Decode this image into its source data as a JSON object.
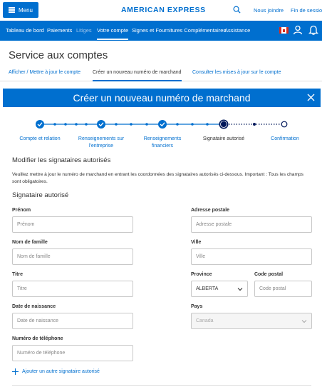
{
  "topbar": {
    "menu_label": "Menu",
    "brand": "AMERICAN EXPRESS",
    "join_label": "Nous joindre",
    "logout_label": "Fin de session"
  },
  "nav": {
    "items": [
      {
        "label": "Tableau de bord"
      },
      {
        "label": "Paiements"
      },
      {
        "label": "Litiges"
      },
      {
        "label": "Votre compte"
      },
      {
        "label": "Signes et Fournitures Complémentaires"
      },
      {
        "label": "Assistance"
      }
    ]
  },
  "page": {
    "title": "Service aux comptes",
    "subtabs": [
      {
        "label": "Afficher / Mettre à jour le compte"
      },
      {
        "label": "Créer un nouveau numéro de marchand"
      },
      {
        "label": "Consulter les mises à jour sur le compte"
      }
    ]
  },
  "modal": {
    "title": "Créer un nouveau numéro de marchand",
    "steps": [
      {
        "label": "Compte et relation"
      },
      {
        "label": "Renseignements sur l'entreprise"
      },
      {
        "label": "Renseignements financiers"
      },
      {
        "label": "Signataire autorisé"
      },
      {
        "label": "Confirmation"
      }
    ],
    "section_title": "Modifier les signataires autorisés",
    "intro": "Veuillez mettre à jour le numéro de marchand en entrant les coordonnées des signataires autorisés ci-dessous. Important : Tous les champs sont obligatoires.",
    "signatory_title": "Signataire autorisé",
    "fields": {
      "first_name": {
        "label": "Prénom",
        "placeholder": "Prénom"
      },
      "address": {
        "label": "Adresse postale",
        "placeholder": "Adresse postale"
      },
      "last_name": {
        "label": "Nom de famille",
        "placeholder": "Nom de famille"
      },
      "city": {
        "label": "Ville",
        "placeholder": "Ville"
      },
      "job_title": {
        "label": "Titre",
        "placeholder": "Titre"
      },
      "province": {
        "label": "Province",
        "value": "ALBERTA"
      },
      "postal_code": {
        "label": "Code postal",
        "placeholder": "Code postal"
      },
      "birth_date": {
        "label": "Date de naissance",
        "placeholder": "Date de naissance"
      },
      "country": {
        "label": "Pays",
        "value": "Canada"
      },
      "phone": {
        "label": "Numéro de téléphone",
        "placeholder": "Numéro de téléphone"
      }
    },
    "add_signatory": "Ajouter un autre signataire autorisé"
  },
  "colors": {
    "brand_blue": "#006fcf",
    "step_dark": "#00175a"
  }
}
